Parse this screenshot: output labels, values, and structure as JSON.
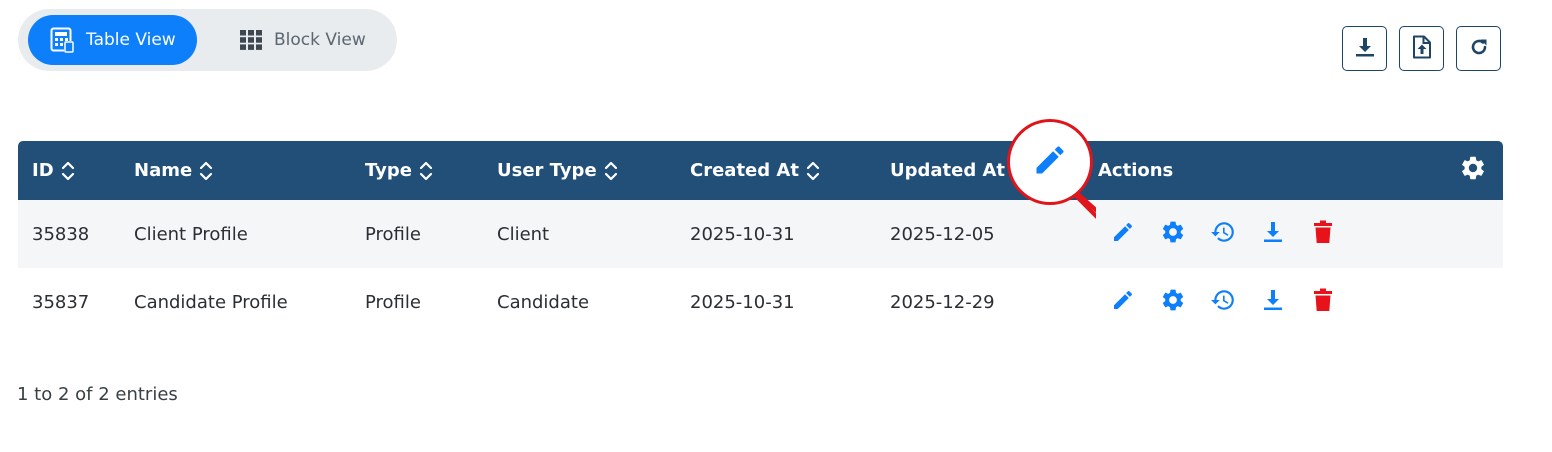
{
  "view_toggle": {
    "table_view": "Table View",
    "block_view": "Block View"
  },
  "toolbar": {
    "download_icon": "download-icon",
    "upload_icon": "upload-file-icon",
    "refresh_icon": "refresh-icon"
  },
  "table": {
    "columns": {
      "id": "ID",
      "name": "Name",
      "type": "Type",
      "user_type": "User Type",
      "created_at": "Created At",
      "updated_at": "Updated At",
      "actions": "Actions"
    },
    "rows": [
      {
        "id": "35838",
        "name": "Client Profile",
        "type": "Profile",
        "user_type": "Client",
        "created_at": "2025-10-31",
        "updated_at": "2025-12-05"
      },
      {
        "id": "35837",
        "name": "Candidate Profile",
        "type": "Profile",
        "user_type": "Candidate",
        "created_at": "2025-10-31",
        "updated_at": "2025-12-29"
      }
    ],
    "action_icons": [
      "edit-icon",
      "settings-icon",
      "history-icon",
      "download-icon",
      "delete-icon"
    ]
  },
  "footer": {
    "entries_info": "1 to 2 of 2 entries"
  },
  "colors": {
    "primary": "#0d7ffb",
    "header_bg": "#224f78",
    "delete": "#e8121a",
    "callout": "#e0151b"
  }
}
